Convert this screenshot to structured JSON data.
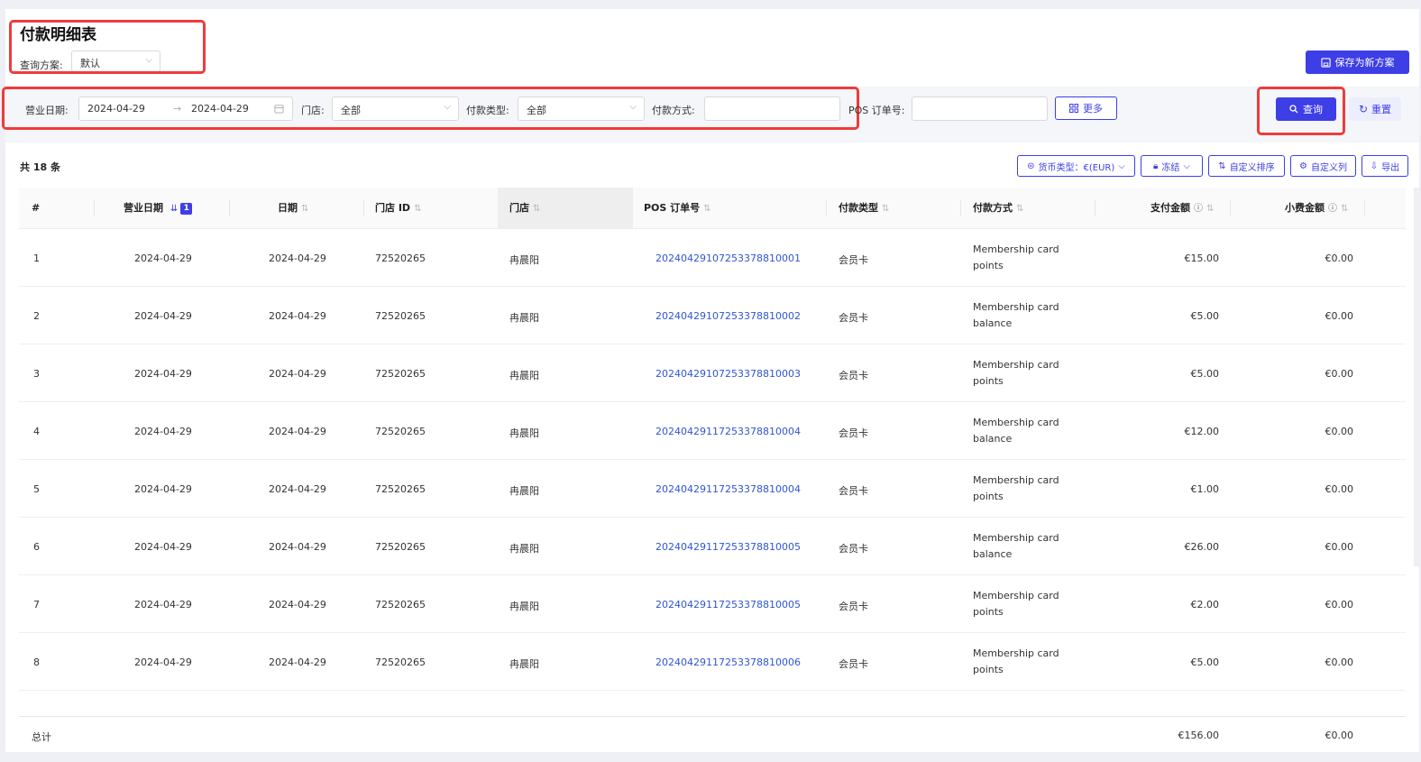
{
  "header": {
    "title": "付款明细表",
    "scheme_label": "查询方案:",
    "scheme_value": "默认",
    "save_label": "保存为新方案"
  },
  "filters": {
    "business_date_label": "营业日期:",
    "date_from": "2024-04-29",
    "date_arrow": "→",
    "date_to": "2024-04-29",
    "store_label": "门店:",
    "store_value": "全部",
    "pay_type_label": "付款类型:",
    "pay_type_value": "全部",
    "pay_method_label": "付款方式:",
    "pay_method_value": "",
    "pos_order_label": "POS 订单号:",
    "pos_order_value": "",
    "more_label": "更多",
    "query_label": "查询",
    "reset_label": "重置"
  },
  "toolbar": {
    "count_label": "共 18 条",
    "currency_label": "货币类型：€(EUR)",
    "freeze_label": "冻结",
    "custom_sort_label": "自定义排序",
    "custom_columns_label": "自定义列",
    "export_label": "导出"
  },
  "table": {
    "headers": [
      "#",
      "营业日期",
      "日期",
      "门店 ID",
      "门店",
      "POS 订单号",
      "付款类型",
      "付款方式",
      "支付金额",
      "小费金额"
    ],
    "sort_badge": "1",
    "rows": [
      {
        "no": "1",
        "business_date": "2024-04-29",
        "date": "2024-04-29",
        "store_id": "72520265",
        "store": "冉晨阳",
        "pos_order": "20240429107253378810001",
        "pay_type": "会员卡",
        "pay_method": "Membership card points",
        "amount": "€15.00",
        "tip": "€0.00"
      },
      {
        "no": "2",
        "business_date": "2024-04-29",
        "date": "2024-04-29",
        "store_id": "72520265",
        "store": "冉晨阳",
        "pos_order": "20240429107253378810002",
        "pay_type": "会员卡",
        "pay_method": "Membership card balance",
        "amount": "€5.00",
        "tip": "€0.00"
      },
      {
        "no": "3",
        "business_date": "2024-04-29",
        "date": "2024-04-29",
        "store_id": "72520265",
        "store": "冉晨阳",
        "pos_order": "20240429107253378810003",
        "pay_type": "会员卡",
        "pay_method": "Membership card points",
        "amount": "€5.00",
        "tip": "€0.00"
      },
      {
        "no": "4",
        "business_date": "2024-04-29",
        "date": "2024-04-29",
        "store_id": "72520265",
        "store": "冉晨阳",
        "pos_order": "20240429117253378810004",
        "pay_type": "会员卡",
        "pay_method": "Membership card balance",
        "amount": "€12.00",
        "tip": "€0.00"
      },
      {
        "no": "5",
        "business_date": "2024-04-29",
        "date": "2024-04-29",
        "store_id": "72520265",
        "store": "冉晨阳",
        "pos_order": "20240429117253378810004",
        "pay_type": "会员卡",
        "pay_method": "Membership card points",
        "amount": "€1.00",
        "tip": "€0.00"
      },
      {
        "no": "6",
        "business_date": "2024-04-29",
        "date": "2024-04-29",
        "store_id": "72520265",
        "store": "冉晨阳",
        "pos_order": "20240429117253378810005",
        "pay_type": "会员卡",
        "pay_method": "Membership card balance",
        "amount": "€26.00",
        "tip": "€0.00"
      },
      {
        "no": "7",
        "business_date": "2024-04-29",
        "date": "2024-04-29",
        "store_id": "72520265",
        "store": "冉晨阳",
        "pos_order": "20240429117253378810005",
        "pay_type": "会员卡",
        "pay_method": "Membership card points",
        "amount": "€2.00",
        "tip": "€0.00"
      },
      {
        "no": "8",
        "business_date": "2024-04-29",
        "date": "2024-04-29",
        "store_id": "72520265",
        "store": "冉晨阳",
        "pos_order": "20240429117253378810006",
        "pay_type": "会员卡",
        "pay_method": "Membership card points",
        "amount": "€5.00",
        "tip": "€0.00"
      }
    ],
    "total_label": "总计",
    "total_amount": "€156.00",
    "total_tip": "€0.00"
  }
}
